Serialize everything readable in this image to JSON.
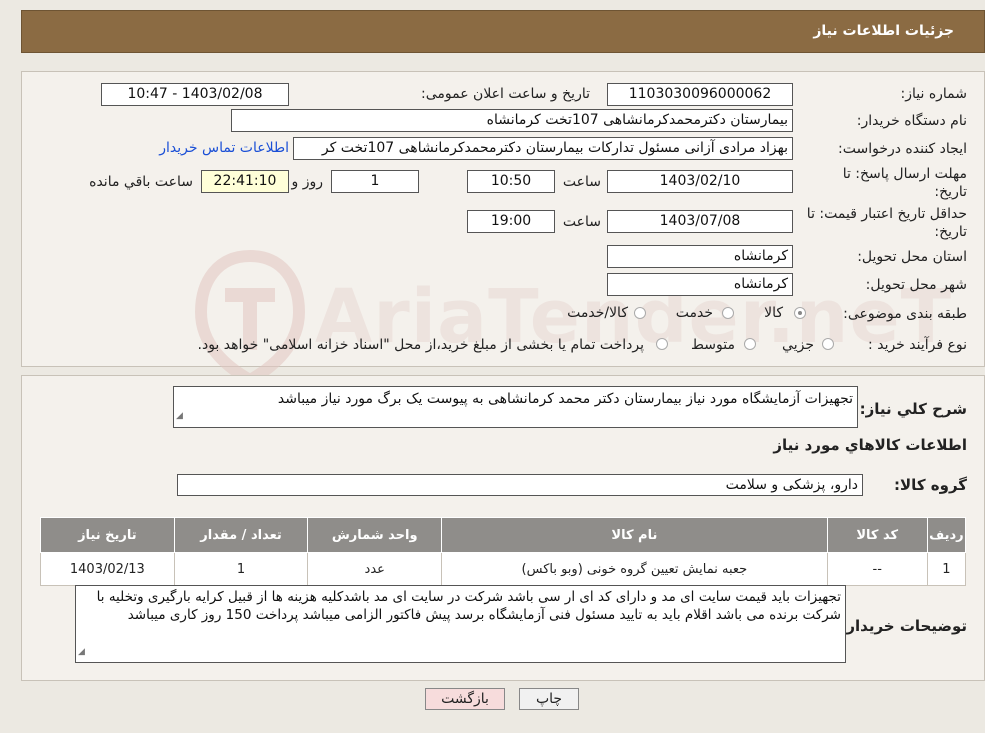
{
  "header": {
    "title": "جزئیات اطلاعات نیاز"
  },
  "fields": {
    "need_number_label": "شماره نیاز:",
    "need_number": "1103030096000062",
    "announce_label": "تاریخ و ساعت اعلان عمومی:",
    "announce_value": "1403/02/08 - 10:47",
    "buyer_org_label": "نام دستگاه خریدار:",
    "buyer_org": "بیمارستان دکترمحمدکرمانشاهی 107تخت کرمانشاه",
    "requester_label": "ایجاد کننده درخواست:",
    "requester": "بهزاد مرادی آزانی مسئول تدارکات بیمارستان دکترمحمدکرمانشاهی 107تخت کر",
    "contact_link": "اطلاعات تماس خریدار",
    "deadline_label_1": "مهلت ارسال پاسخ: تا",
    "deadline_label_2": "تاریخ:",
    "deadline_date": "1403/02/10",
    "time_label": "ساعت",
    "deadline_time": "10:50",
    "days_value": "1",
    "days_label": "روز و",
    "remaining_time": "22:41:10",
    "remaining_label": "ساعت باقي مانده",
    "validity_label_1": "حداقل تاریخ اعتبار قیمت: تا",
    "validity_label_2": "تاریخ:",
    "validity_date": "1403/07/08",
    "validity_time": "19:00",
    "province_label": "استان محل تحویل:",
    "province": "کرمانشاه",
    "city_label": "شهر محل تحویل:",
    "city": "کرمانشاه",
    "category_label": "طبقه بندی موضوعی:",
    "category_options": [
      "کالا",
      "خدمت",
      "کالا/خدمت"
    ],
    "process_label": "نوع فرآیند خرید :",
    "process_options": [
      "جزیي",
      "متوسط"
    ],
    "process_note": "پرداخت تمام یا بخشی از مبلغ خرید،از محل \"اسناد خزانه اسلامی\" خواهد بود."
  },
  "description": {
    "label": "شرح کلي نیاز:",
    "value": "تجهیزات آزمایشگاه مورد نیاز بیمارستان دکتر محمد کرمانشاهی به پیوست یک برگ مورد نیاز میباشد",
    "goods_info_title": "اطلاعات کالاهاي مورد نیاز",
    "group_label": "گروه کالا:",
    "group_value": "دارو، پزشکی و سلامت"
  },
  "table": {
    "headers": [
      "ردیف",
      "کد کالا",
      "نام کالا",
      "واحد شمارش",
      "تعداد / مقدار",
      "تاریخ نیاز"
    ],
    "rows": [
      [
        "1",
        "--",
        "جعبه نمایش تعیین گروه خونی (وبو باکس)",
        "عدد",
        "1",
        "1403/02/13"
      ]
    ]
  },
  "buyer_notes": {
    "label": "توضیحات خریدار:",
    "value": "تجهیزات باید قیمت سایت ای مد و دارای کد ای ار سی باشد شرکت در سایت ای مد باشدکلیه هزینه ها از قبیل کرایه بارگیری وتخلیه با شرکت برنده می باشد اقلام باید به تایید مسئول فنی آزمایشگاه برسد پیش فاکتور الزامی میباشد پرداخت 150 روز کاری میباشد"
  },
  "buttons": {
    "print": "چاپ",
    "back": "بازگشت"
  },
  "watermark": "AriaTender.neT",
  "colors": {
    "header": "#8b6b43",
    "table_header": "#8f8d8a",
    "back_button": "#f7dcdc",
    "link": "#1a4fd6"
  }
}
